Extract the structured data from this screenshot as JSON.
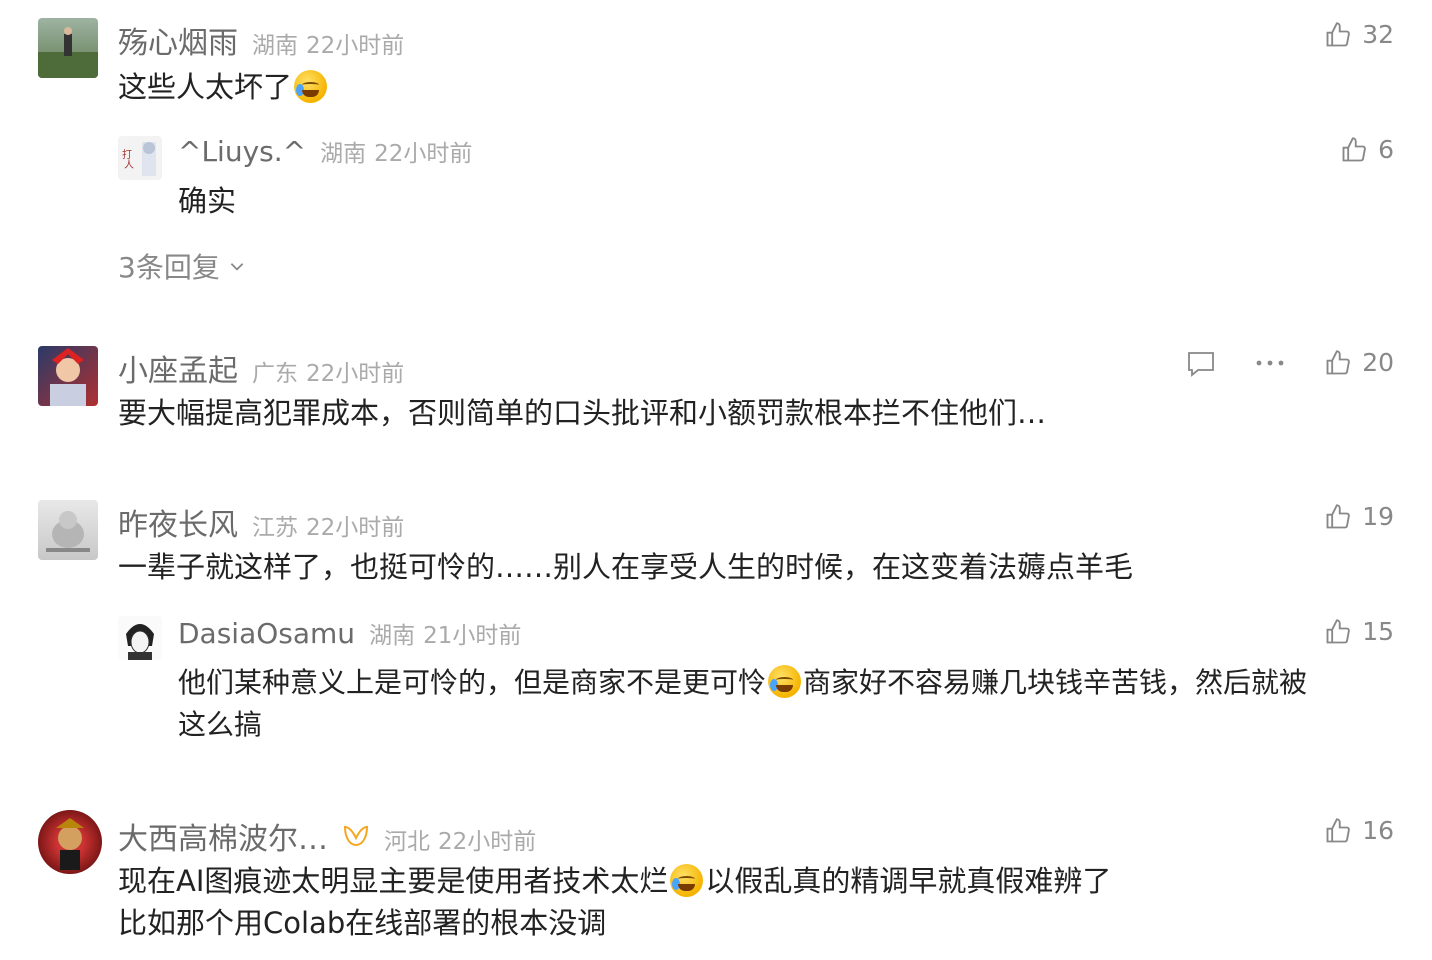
{
  "comments": [
    {
      "name": "殇心烟雨",
      "location": "湖南",
      "time": "22小时前",
      "likes": "32",
      "text": "这些人太坏了",
      "replies": [
        {
          "name": "^Liuys.^",
          "location": "湖南",
          "time": "22小时前",
          "likes": "6",
          "text": "确实"
        }
      ],
      "more_replies_label": "3条回复"
    },
    {
      "name": "小座孟起",
      "location": "广东",
      "time": "22小时前",
      "likes": "20",
      "text": "要大幅提高犯罪成本，否则简单的口头批评和小额罚款根本拦不住他们…"
    },
    {
      "name": "昨夜长风",
      "location": "江苏",
      "time": "22小时前",
      "likes": "19",
      "text": "一辈子就这样了，也挺可怜的……别人在享受人生的时候，在这变着法薅点羊毛",
      "replies": [
        {
          "name": "DasiaOsamu",
          "location": "湖南",
          "time": "21小时前",
          "likes": "15",
          "text_line1_a": "他们某种意义上是可怜的，但是商家不是更可怜",
          "text_line1_b": "商家好不容易赚几块钱辛苦钱，然后就被",
          "text_line2": "这么搞"
        }
      ]
    },
    {
      "name": "大西高棉波尔…",
      "location": "河北",
      "time": "22小时前",
      "likes": "16",
      "text_line1_a": "现在AI图痕迹太明显主要是使用者技术太烂",
      "text_line1_b": "以假乱真的精调早就真假难辨了",
      "text_line2": "比如那个用Colab在线部署的根本没调"
    }
  ],
  "colors": {
    "name": "#6b6b6b",
    "meta": "#aaaaaa",
    "text": "#222222",
    "icon": "#888888",
    "badge": "#f5a623"
  },
  "icons": [
    "thumbs-up-icon",
    "reply-icon",
    "more-icon",
    "chevron-down-icon",
    "verified-badge-icon"
  ]
}
